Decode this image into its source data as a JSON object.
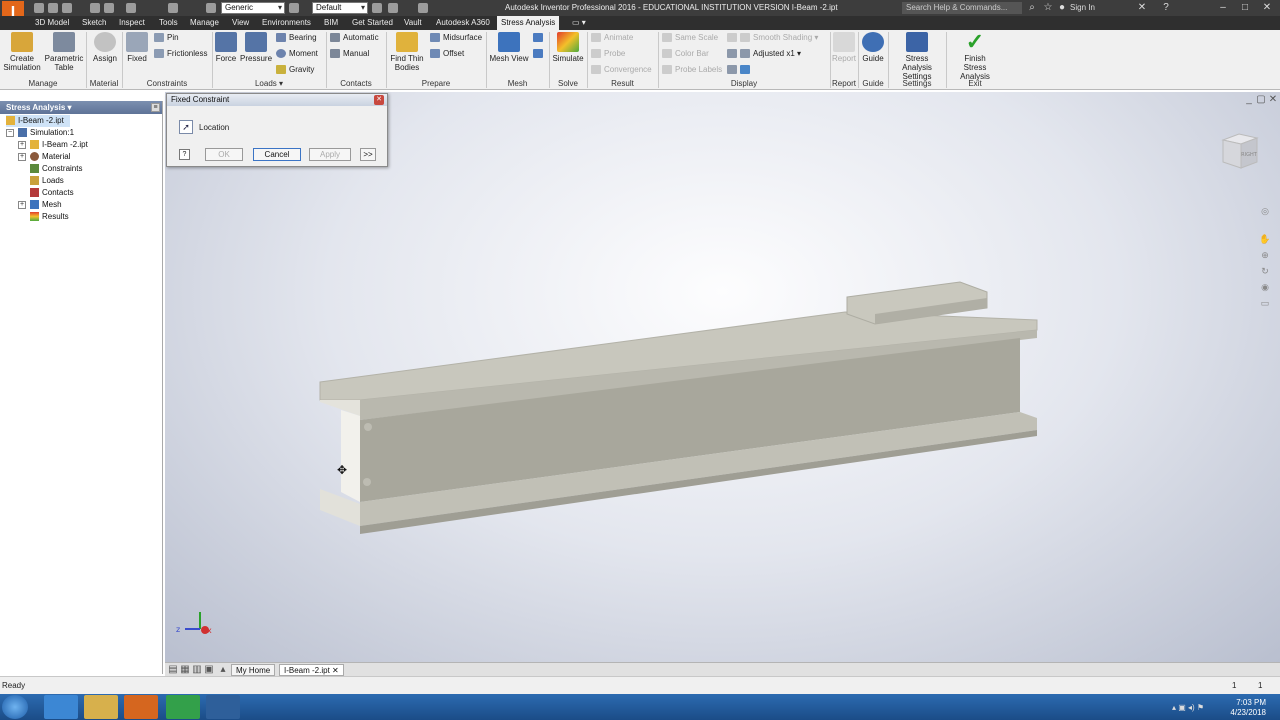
{
  "app": {
    "window_title": "Autodesk Inventor Professional 2016 - EDUCATIONAL INSTITUTION VERSION    I-Beam -2.ipt",
    "logo_text": "I",
    "appearance_combo": "Generic",
    "material_combo": "Default",
    "search_placeholder": "Search Help & Commands...",
    "sign_in": "Sign In"
  },
  "tabs": [
    "3D Model",
    "Sketch",
    "Inspect",
    "Tools",
    "Manage",
    "View",
    "Environments",
    "BIM",
    "Get Started",
    "Vault",
    "Autodesk A360",
    "Stress Analysis"
  ],
  "active_tab": "Stress Analysis",
  "ribbon": {
    "create_simulation": "Create\nSimulation",
    "parametric_table": "Parametric\nTable",
    "assign": "Assign",
    "fixed": "Fixed",
    "pin": "Pin",
    "frictionless": "Frictionless",
    "force": "Force",
    "pressure": "Pressure",
    "bearing": "Bearing",
    "moment": "Moment",
    "gravity": "Gravity",
    "automatic": "Automatic",
    "manual": "Manual",
    "find_thin_bodies": "Find Thin\nBodies",
    "midsurface": "Midsurface",
    "offset": "Offset",
    "mesh_view": "Mesh View",
    "simulate": "Simulate",
    "animate": "Animate",
    "probe": "Probe",
    "convergence": "Convergence",
    "same_scale": "Same Scale",
    "color_bar": "Color Bar",
    "probe_labels": "Probe Labels",
    "smooth_shading": "Smooth Shading",
    "adjusted": "Adjusted x1",
    "report": "Report",
    "guide": "Guide",
    "stress_settings": "Stress Analysis\nSettings",
    "finish": "Finish\nStress Analysis",
    "panels": {
      "manage": "Manage",
      "material": "Material",
      "constraints": "Constraints",
      "loads": "Loads ▾",
      "contacts": "Contacts",
      "prepare": "Prepare",
      "mesh": "Mesh",
      "solve": "Solve",
      "result": "Result",
      "display": "Display",
      "report": "Report",
      "guide": "Guide",
      "settings": "Settings",
      "exit": "Exit"
    }
  },
  "browser": {
    "title": "Stress Analysis ▾",
    "items": [
      {
        "label": "I-Beam -2.ipt"
      },
      {
        "label": "Simulation:1"
      },
      {
        "label": "I-Beam -2.ipt"
      },
      {
        "label": "Material"
      },
      {
        "label": "Constraints"
      },
      {
        "label": "Loads"
      },
      {
        "label": "Contacts"
      },
      {
        "label": "Mesh"
      },
      {
        "label": "Results"
      }
    ]
  },
  "dialog": {
    "title": "Fixed Constraint",
    "location_label": "Location",
    "ok": "OK",
    "cancel": "Cancel",
    "apply": "Apply",
    "more": ">>"
  },
  "viewcube_label": "RIGHT",
  "document_tabs": {
    "home": "My Home",
    "file": "I-Beam -2.ipt"
  },
  "status": {
    "text": "Ready",
    "count_a": "1",
    "count_b": "1"
  },
  "taskbar": {
    "time": "7:03 PM",
    "date": "4/23/2018"
  }
}
